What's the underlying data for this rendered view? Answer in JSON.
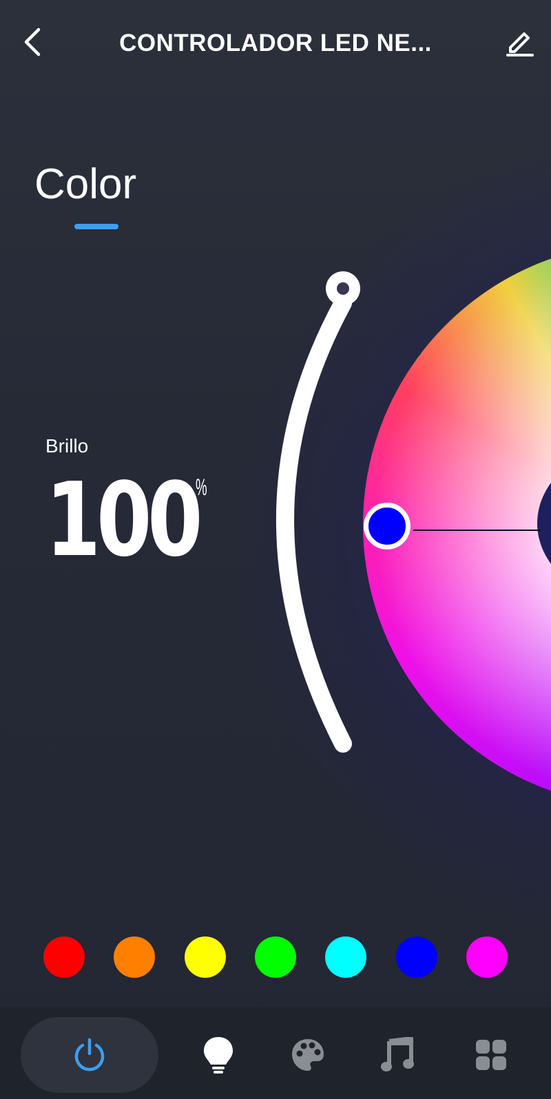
{
  "header": {
    "title": "CONTROLADOR LED NE...",
    "back_icon": "chevron-left-icon",
    "edit_icon": "pencil-icon"
  },
  "tab": {
    "label": "Color",
    "accent_color": "#3d9ef0"
  },
  "brightness": {
    "label": "Brillo",
    "value": "100",
    "unit": "%",
    "level": 1.0
  },
  "color_wheel": {
    "selected_color": "#0000ff"
  },
  "swatches": [
    {
      "name": "red",
      "color": "#ff0000"
    },
    {
      "name": "orange",
      "color": "#ff8000"
    },
    {
      "name": "yellow",
      "color": "#ffff00"
    },
    {
      "name": "green",
      "color": "#00ff00"
    },
    {
      "name": "cyan",
      "color": "#00ffff"
    },
    {
      "name": "blue",
      "color": "#0000ff"
    },
    {
      "name": "magenta",
      "color": "#ff00ff"
    }
  ],
  "bottom_nav": {
    "items": [
      {
        "icon": "power-icon",
        "active": true,
        "color": "#3d9ef0"
      },
      {
        "icon": "bulb-icon",
        "active": false,
        "color": "#ffffff"
      },
      {
        "icon": "palette-icon",
        "active": false,
        "color": "#8a8d93"
      },
      {
        "icon": "music-icon",
        "active": false,
        "color": "#8a8d93"
      },
      {
        "icon": "grid-icon",
        "active": false,
        "color": "#8a8d93"
      }
    ]
  }
}
